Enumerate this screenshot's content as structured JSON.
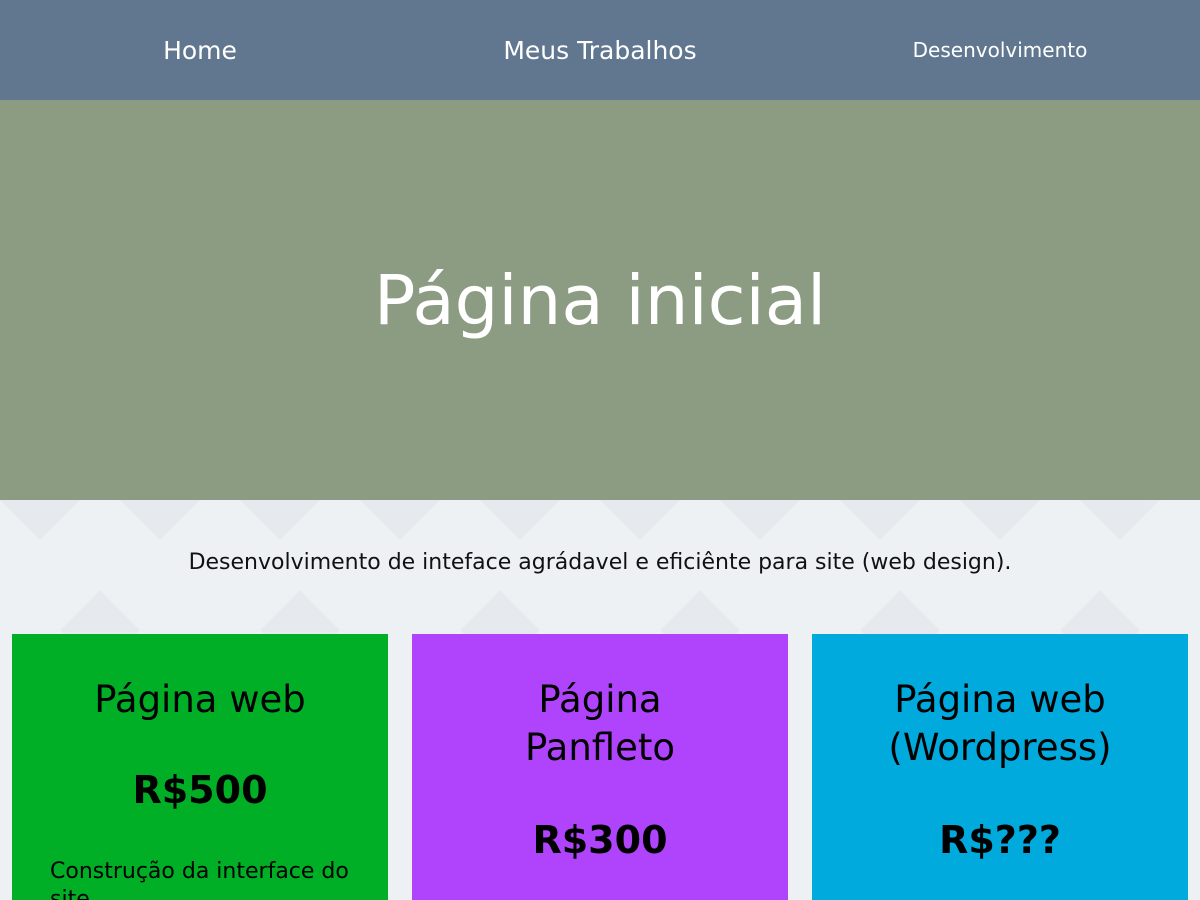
{
  "nav": {
    "items": [
      {
        "label": "Home"
      },
      {
        "label": "Meus Trabalhos"
      },
      {
        "label": "Desenvolvimento"
      }
    ]
  },
  "hero": {
    "title": "Página inicial"
  },
  "main": {
    "tagline": "Desenvolvimento de inteface agrádavel e eficiênte para site (web design).",
    "cards": [
      {
        "title": "Página web",
        "price": "R$500",
        "description": "Construção da interface do site"
      },
      {
        "title": "Página Panfleto",
        "price": "R$300"
      },
      {
        "title": "Página web (Wordpress)",
        "price": "R$???"
      }
    ]
  },
  "colors": {
    "nav_bg": "#60778f",
    "hero_bg": "#8c9c83",
    "page_bg": "#eef1f4",
    "card_green": "#00af25",
    "card_purple": "#b044fc",
    "card_blue": "#00aadd"
  }
}
